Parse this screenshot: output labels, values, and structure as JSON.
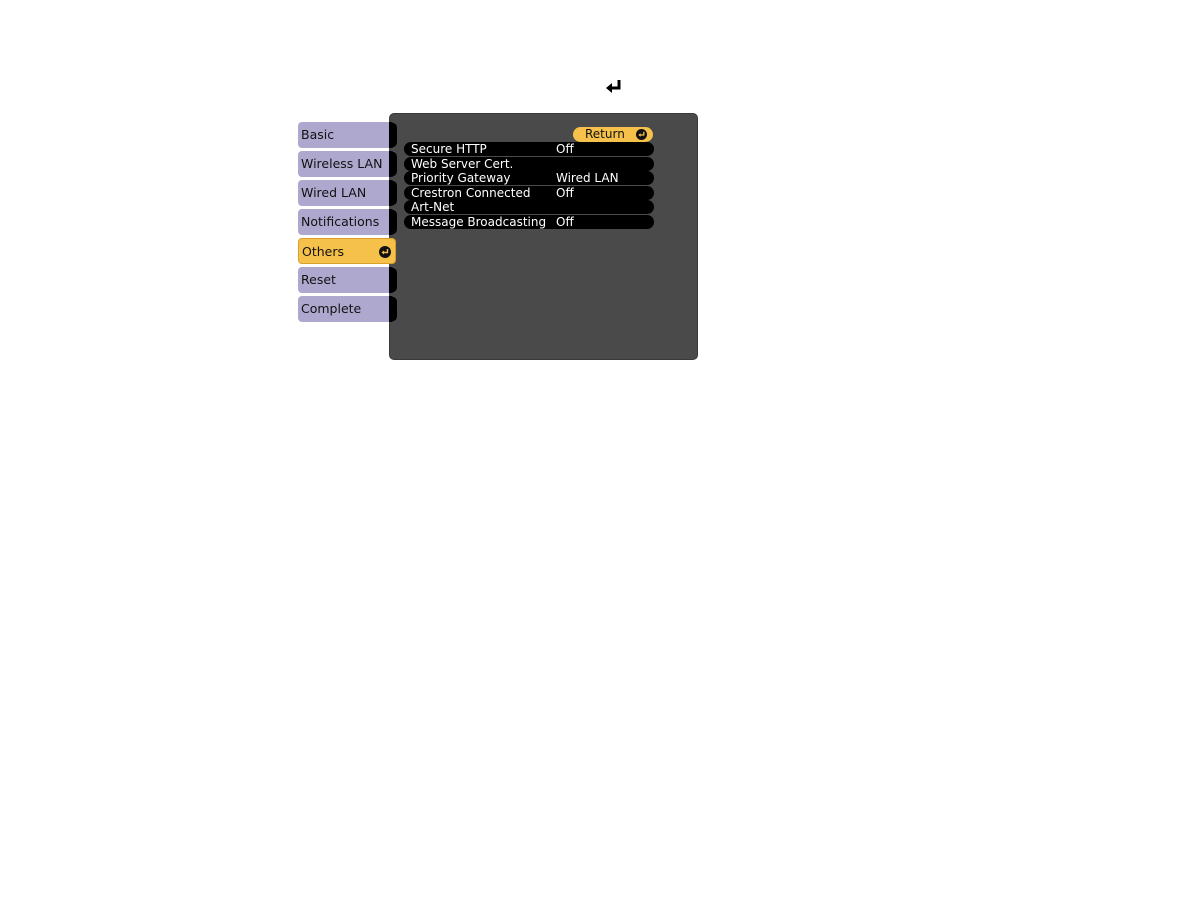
{
  "header": {
    "icon": "enter-icon"
  },
  "sidebar": {
    "items": [
      {
        "label": "Basic",
        "active": false
      },
      {
        "label": "Wireless LAN",
        "active": false
      },
      {
        "label": "Wired LAN",
        "active": false
      },
      {
        "label": "Notifications",
        "active": false
      },
      {
        "label": "Others",
        "active": true,
        "icon": "enter-icon"
      },
      {
        "label": "Reset",
        "active": false
      },
      {
        "label": "Complete",
        "active": false
      }
    ]
  },
  "panel": {
    "return_label": "Return",
    "return_icon": "enter-icon",
    "settings": [
      {
        "label": "Secure HTTP",
        "value": "Off"
      },
      {
        "label": "Web Server Cert.",
        "value": ""
      },
      {
        "label": "Priority Gateway",
        "value": "Wired LAN"
      },
      {
        "label": "Crestron Connected",
        "value": "Off"
      },
      {
        "label": "Art-Net",
        "value": ""
      },
      {
        "label": "Message Broadcasting",
        "value": "Off"
      }
    ]
  },
  "colors": {
    "panel_bg": "#4a4a4a",
    "sidebar_item": "#aea8cf",
    "active_item": "#f5c14a",
    "row_bg": "#000000",
    "row_text": "#ffffff"
  }
}
